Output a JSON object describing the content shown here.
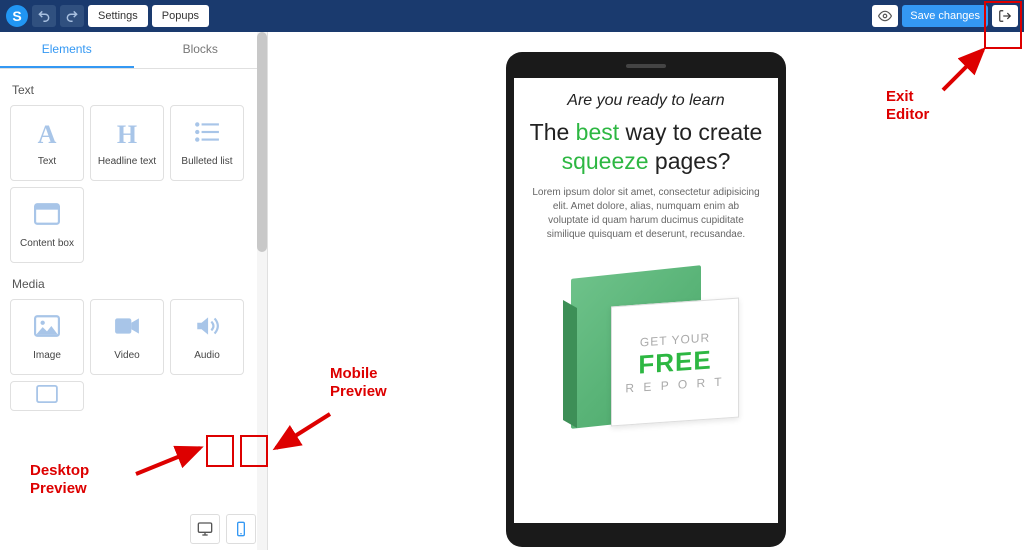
{
  "topbar": {
    "logo_letter": "S",
    "settings_label": "Settings",
    "popups_label": "Popups",
    "save_label": "Save changes"
  },
  "sidebar": {
    "tabs": {
      "elements": "Elements",
      "blocks": "Blocks"
    },
    "sections": {
      "text": {
        "title": "Text",
        "tiles": [
          {
            "glyph": "A",
            "label": "Text"
          },
          {
            "glyph": "H",
            "label": "Headline text"
          },
          {
            "glyph": "≣",
            "label": "Bulleted list"
          },
          {
            "glyph": "▭",
            "label": "Content box"
          }
        ]
      },
      "media": {
        "title": "Media",
        "tiles": [
          {
            "glyph": "image",
            "label": "Image"
          },
          {
            "glyph": "video",
            "label": "Video"
          },
          {
            "glyph": "audio",
            "label": "Audio"
          }
        ]
      }
    }
  },
  "page": {
    "line1": "Are you ready to learn",
    "headline_pre": "The ",
    "headline_best": "best",
    "headline_mid": " way to create ",
    "headline_squeeze": "squeeze",
    "headline_post": " pages?",
    "lorem": "Lorem ipsum dolor sit amet, consectetur adipisicing elit. Amet dolore, alias, numquam enim ab voluptate id quam harum ducimus cupiditate similique quisquam et deserunt, recusandae.",
    "box": {
      "get_your": "GET YOUR",
      "free": "FREE",
      "report": "R E P O R T"
    }
  },
  "annotations": {
    "mobile": "Mobile Preview",
    "desktop": "Desktop Preview",
    "exit": "Exit Editor"
  }
}
